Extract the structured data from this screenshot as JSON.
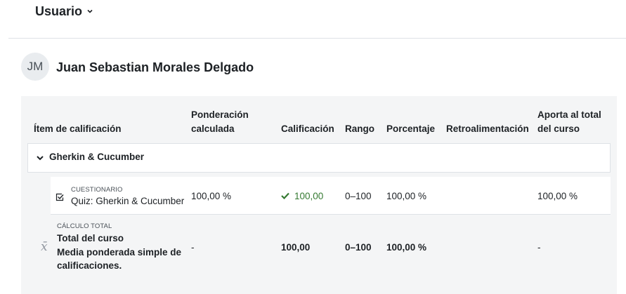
{
  "header": {
    "user_menu_label": "Usuario"
  },
  "user": {
    "initials": "JM",
    "full_name": "Juan Sebastian Morales Delgado"
  },
  "table": {
    "headers": {
      "item": "Ítem de calificación",
      "weight_l1": "Ponderación",
      "weight_l2": "calculada",
      "grade": "Calificación",
      "range": "Rango",
      "percentage": "Porcentaje",
      "feedback": "Retroalimentación",
      "contrib_l1": "Aporta al total",
      "contrib_l2": "del curso"
    },
    "category": {
      "name": "Gherkin & Cucumber"
    },
    "item_row": {
      "type_label": "CUESTIONARIO",
      "name": "Quiz: Gherkin & Cucumber",
      "weight": "100,00 %",
      "grade": "100,00",
      "range": "0–100",
      "percentage": "100,00 %",
      "feedback": "",
      "contribution": "100,00 %"
    },
    "total_row": {
      "type_label": "CÁLCULO TOTAL",
      "name_l1": "Total del curso",
      "name_l2": "Media ponderada simple de",
      "name_l3": "calificaciones.",
      "weight": "-",
      "grade": "100,00",
      "range": "0–100",
      "percentage": "100,00 %",
      "contribution": "-"
    }
  },
  "colors": {
    "success": "#357a32",
    "panel_bg": "#f4f5f6",
    "border": "#dee2e6"
  }
}
